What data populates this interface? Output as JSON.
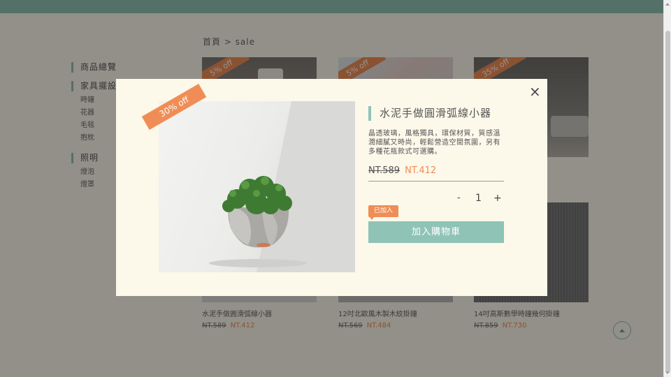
{
  "breadcrumb": "首頁 > sale",
  "sidebar": {
    "groups": [
      {
        "label": "商品總覽",
        "items": []
      },
      {
        "label": "家具擺設",
        "items": [
          "時鐘",
          "花器",
          "毛毯",
          "抱枕"
        ]
      },
      {
        "label": "照明",
        "items": [
          "燈泡",
          "燈罩"
        ]
      }
    ]
  },
  "products": [
    {
      "badge": "5% off",
      "name": "水泥手做圓滑弧線小器",
      "old_price": "NT.589",
      "new_price": "NT.412"
    },
    {
      "badge": "5% off",
      "name": "12吋北歐風木製木紋掛鐘",
      "old_price": "NT.569",
      "new_price": "NT.484"
    },
    {
      "badge": "35% off",
      "name": "14吋高斯數學時鐘幾何掛鐘",
      "old_price": "NT.859",
      "new_price": "NT.730"
    }
  ],
  "modal": {
    "badge": "30% off",
    "title": "水泥手做圓滑弧線小器",
    "description": "晶透玻璃，風格獨具，環保材質，質感溫潤細膩又時尚，輕鬆營造空間氛圍，另有多種花瓶款式可選購。",
    "old_price": "NT.589",
    "new_price": "NT.412",
    "qty_minus": "-",
    "quantity": "1",
    "qty_plus": "+",
    "added_badge": "已加入",
    "cart_button": "加入購物車",
    "close": "×"
  },
  "colors": {
    "accent": "#8fc3b6",
    "sale": "#f08d56",
    "background": "#fcf8ea"
  }
}
